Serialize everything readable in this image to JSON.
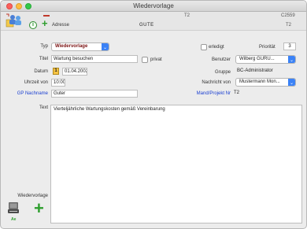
{
  "window": {
    "title": "Wiedervorlage"
  },
  "toolbar": {
    "adresse_label": "Adresse",
    "name_value": "GUTE",
    "code_top_center": "T2",
    "code_top_right": "C2559",
    "code_bottom_right": "T2",
    "info_glyph": "i"
  },
  "form": {
    "typ": {
      "label": "Typ",
      "value": "Wiedervorlage"
    },
    "erledigt": {
      "label": "erledigt"
    },
    "prioritaet": {
      "label": "Priorität",
      "value": "3"
    },
    "titel": {
      "label": "Titel",
      "value": "Wartung besuchen"
    },
    "privat": {
      "label": "privat"
    },
    "benutzer": {
      "label": "Benutzer",
      "value": "Wilberg GURU..."
    },
    "datum": {
      "label": "Datum",
      "value": "01.04.2002",
      "cal_glyph": "1"
    },
    "gruppe": {
      "label": "Gruppe",
      "value": "BC-Administrator"
    },
    "uhrzeit": {
      "label": "Uhrzeit von",
      "value": "10:00"
    },
    "nachricht": {
      "label": "Nachricht von",
      "value": "Mustermann Mon..."
    },
    "gp_nachname": {
      "label": "GP Nachname",
      "value": "Guter"
    },
    "mand_projekt": {
      "label": "Mand/Projekt Nr",
      "value": "T2"
    },
    "text": {
      "label": "Text",
      "value": "Vierteljährliche Wartungskosten gemäß Vereinbarung"
    }
  },
  "footer": {
    "wiedervorlage_label": "Wiedervorlage",
    "tag": "Ae"
  },
  "colors": {
    "accent_blue": "#3b82f6",
    "link_blue": "#1a3fd1",
    "add_green": "#2e9e2e",
    "remove_red": "#c0392b"
  }
}
